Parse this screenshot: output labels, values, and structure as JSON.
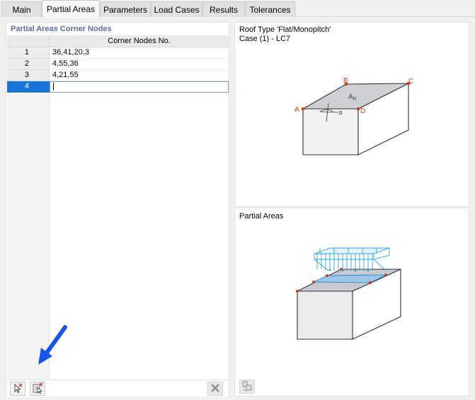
{
  "tabs": [
    {
      "label": "Main",
      "active": false
    },
    {
      "label": "Partial Areas",
      "active": true
    },
    {
      "label": "Parameters",
      "active": false
    },
    {
      "label": "Load Cases",
      "active": false
    },
    {
      "label": "Results",
      "active": false
    },
    {
      "label": "Tolerances",
      "active": false
    }
  ],
  "left": {
    "section_title": "Partial Areas Corner Nodes",
    "column_header": "Corner Nodes No.",
    "rows": [
      {
        "num": "1",
        "value": "36,41,20,3"
      },
      {
        "num": "2",
        "value": "4,55,36"
      },
      {
        "num": "3",
        "value": "4,21,55"
      },
      {
        "num": "4",
        "value": ""
      }
    ],
    "active_row": "4",
    "toolbar": {
      "pick_button_icon": "pick-node-icon",
      "pick_multi_button_icon": "pick-nodes-list-icon",
      "delete_button_icon": "close-icon"
    }
  },
  "roof": {
    "title_line1": "Roof Type 'Flat/Monopitch'",
    "title_line2": "Case (1) - LC7",
    "label_A": "A",
    "label_B": "B",
    "label_C": "C",
    "label_D": "D",
    "label_AR": "A",
    "label_AR_sub": "R",
    "label_alpha": "α",
    "accent": "#d23c1e"
  },
  "partial": {
    "title": "Partial Areas",
    "load_color": "#2aa6e0",
    "toolbar_icon": "view-options-icon"
  },
  "colors": {
    "selection": "#1874d6",
    "section_title": "#5a6f9a",
    "arrow": "#1a55e8"
  }
}
